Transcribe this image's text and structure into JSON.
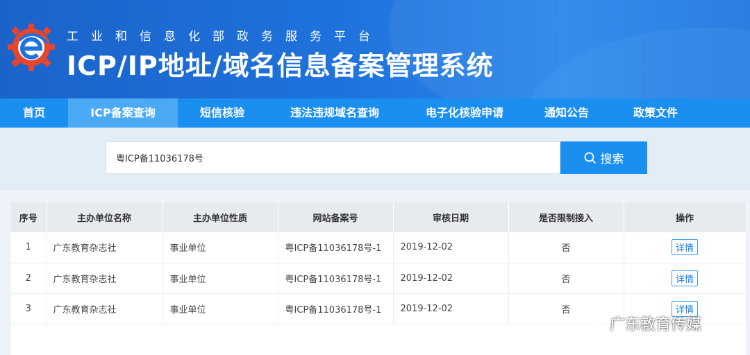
{
  "header": {
    "subtitle": "工业和信息化部政务服务平台",
    "title": "ICP/IP地址/域名信息备案管理系统",
    "colors": {
      "banner": "#1f72dc",
      "nav": "#1a8ff0",
      "nav_active": "#4aaaf5",
      "logo_red": "#e8452c"
    }
  },
  "nav": {
    "items": [
      {
        "label": "首页"
      },
      {
        "label": "ICP备案查询"
      },
      {
        "label": "短信核验"
      },
      {
        "label": "违法违规域名查询"
      },
      {
        "label": "电子化核验申请"
      },
      {
        "label": "通知公告"
      },
      {
        "label": "政策文件"
      }
    ],
    "active_index": 1
  },
  "search": {
    "value": "粤ICP备11036178号",
    "button_label": "搜索",
    "button_icon": "search-icon"
  },
  "table": {
    "columns": [
      "序号",
      "主办单位名称",
      "主办单位性质",
      "网站备案号",
      "审核日期",
      "是否限制接入",
      "操作"
    ],
    "rows": [
      {
        "index": "1",
        "name": "广东教育杂志社",
        "nature": "事业单位",
        "record": "粤ICP备11036178号-1",
        "date": "2019-12-02",
        "restricted": "否",
        "action": "详情"
      },
      {
        "index": "2",
        "name": "广东教育杂志社",
        "nature": "事业单位",
        "record": "粤ICP备11036178号-1",
        "date": "2019-12-02",
        "restricted": "否",
        "action": "详情"
      },
      {
        "index": "3",
        "name": "广东教育杂志社",
        "nature": "事业单位",
        "record": "粤ICP备11036178号-1",
        "date": "2019-12-02",
        "restricted": "否",
        "action": "详情"
      }
    ]
  },
  "watermark": {
    "text": "广东教育传媒",
    "icon": "wechat-icon"
  }
}
